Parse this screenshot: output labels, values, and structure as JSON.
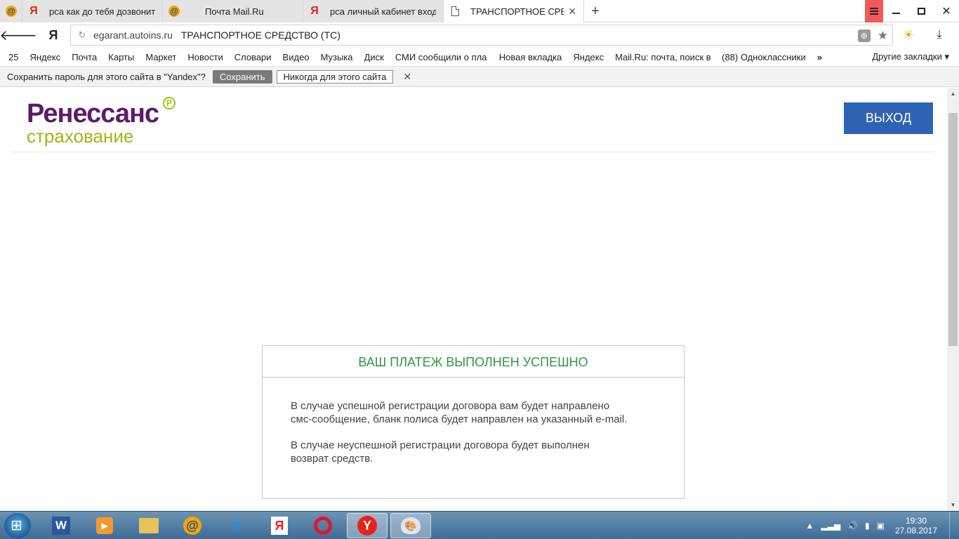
{
  "tabs": [
    {
      "title": "рса как до тебя дозвонитьс",
      "favicon": "yandex-icon",
      "active": false
    },
    {
      "title": "Почта Mail.Ru",
      "favicon": "mailru-icon",
      "active": false
    },
    {
      "title": "рса личный кабинет вход –",
      "favicon": "yandex-icon",
      "active": false
    },
    {
      "title": "ТРАНСПОРТНОЕ СРЕДСТ",
      "favicon": "document-icon",
      "active": true
    }
  ],
  "address_bar": {
    "domain": "egarant.autoins.ru",
    "page_title": "ТРАНСПОРТНОЕ СРЕДСТВО (ТС)"
  },
  "bookmarks": {
    "items": [
      "25",
      "Яндекс",
      "Почта",
      "Карты",
      "Маркет",
      "Новости",
      "Словари",
      "Видео",
      "Музыка",
      "Диск",
      "СМИ сообщили о пла",
      "Новая вкладка",
      "Яндекс",
      "Mail.Ru: почта, поиск в",
      "(88) Одноклассники"
    ],
    "more": "»",
    "other": "Другие закладки ▾"
  },
  "password_bar": {
    "message": "Сохранить пароль для этого сайта в \"Yandex\"?",
    "save_label": "Сохранить",
    "never_label": "Никогда для этого сайта",
    "close": "✕"
  },
  "site": {
    "logo_line1": "Ренессанс",
    "logo_line2": "страхование",
    "logo_reg": "Р",
    "exit_label": "ВЫХОД",
    "brand_purple": "#5b1b6b",
    "brand_green": "#a3b516",
    "button_blue": "#2e63b4"
  },
  "message": {
    "title": "ВАШ ПЛАТЕЖ ВЫПОЛНЕН УСПЕШНО",
    "para1_line1": "В случае успешной регистрации договора вам будет направлено",
    "para1_line2": "смс-сообщение, бланк полиса будет направлен на указанный e-mail.",
    "para2_line1": "В случае неуспешной регистрации договора будет выполнен",
    "para2_line2": "возврат средств.",
    "title_color": "#2c9a3f"
  },
  "taskbar": {
    "apps": [
      "word-icon",
      "media-player-icon",
      "explorer-folder-icon",
      "mail-agent-icon",
      "internet-explorer-icon",
      "yandex-icon",
      "opera-icon",
      "yandex-browser-icon",
      "paint-icon"
    ],
    "time": "19:30",
    "date": "27.08.2017"
  }
}
